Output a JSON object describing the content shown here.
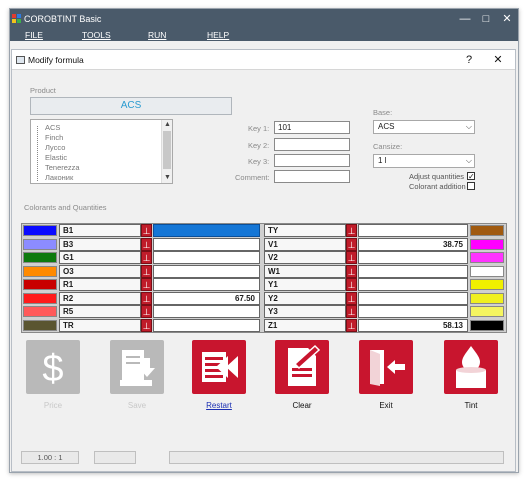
{
  "app": {
    "title": "COROBTINT Basic",
    "menu": [
      "FILE",
      "TOOLS",
      "RUN",
      "HELP"
    ],
    "window_buttons": {
      "minimize": "—",
      "maximize": "□",
      "close": "✕"
    }
  },
  "dialog": {
    "title": "Modify formula",
    "help": "?",
    "close": "✕"
  },
  "product": {
    "label": "Product",
    "value": "ACS",
    "list": [
      "ACS",
      "Finch",
      "Лyссо",
      "Elastic",
      "Tenerezza",
      "Лаконик"
    ]
  },
  "keys": {
    "key1_label": "Key 1:",
    "key1_value": "101",
    "key2_label": "Key 2:",
    "key2_value": "",
    "key3_label": "Key 3:",
    "key3_value": "",
    "comment_label": "Comment:",
    "comment_value": ""
  },
  "base": {
    "label": "Base:",
    "value": "ACS",
    "cansize_label": "Cansize:",
    "cansize_value": "1 l",
    "adjust_label": "Adjust quantities",
    "adjust_checked": "✓",
    "addition_label": "Colorant addition"
  },
  "colorants": {
    "label": "Colorants and Quantities",
    "pin_glyph": "⊥",
    "left": [
      {
        "code": "B1",
        "color": "#0a0aff",
        "value": "",
        "selected": true
      },
      {
        "code": "B3",
        "color": "#8c8cff",
        "value": ""
      },
      {
        "code": "G1",
        "color": "#0e7a0e",
        "value": ""
      },
      {
        "code": "O3",
        "color": "#ff8a00",
        "value": ""
      },
      {
        "code": "R1",
        "color": "#c80000",
        "value": ""
      },
      {
        "code": "R2",
        "color": "#ff1a1a",
        "value": "67.50"
      },
      {
        "code": "R5",
        "color": "#ff5a5a",
        "value": ""
      },
      {
        "code": "TR",
        "color": "#5a5530",
        "value": ""
      }
    ],
    "right": [
      {
        "code": "TY",
        "color": "#a05a10",
        "value": ""
      },
      {
        "code": "V1",
        "color": "#ff00ff",
        "value": "38.75"
      },
      {
        "code": "V2",
        "color": "#ff33ff",
        "value": ""
      },
      {
        "code": "W1",
        "color": "#ffffff",
        "value": ""
      },
      {
        "code": "Y1",
        "color": "#f0f000",
        "value": ""
      },
      {
        "code": "Y2",
        "color": "#f0f020",
        "value": ""
      },
      {
        "code": "Y3",
        "color": "#f5f560",
        "value": ""
      },
      {
        "code": "Z1",
        "color": "#000000",
        "value": "58.13"
      }
    ]
  },
  "actions": {
    "price": "Price",
    "save": "Save",
    "restart": "Restart",
    "clear": "Clear",
    "exit": "Exit",
    "tint": "Tint",
    "accent": "#c8152e",
    "disabled": "#b8b8b8"
  },
  "status": {
    "zoom": "1.00 : 1",
    "field2": "",
    "field3": ""
  }
}
